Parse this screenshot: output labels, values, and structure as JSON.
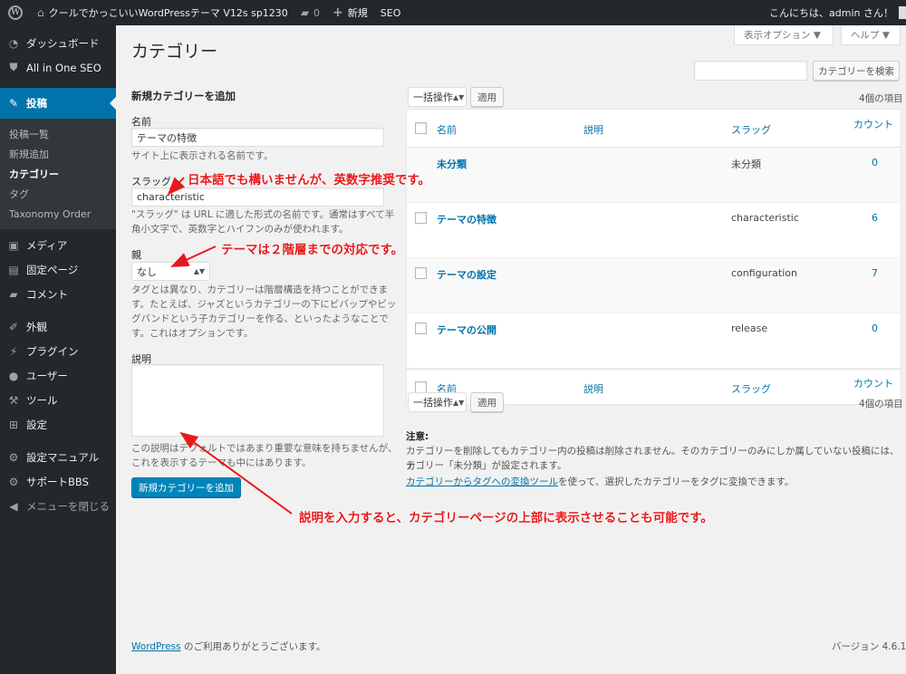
{
  "adminbar": {
    "wp_logo": "W",
    "site_name": "クールでかっこいいWordPressテーマ V12s sp1230",
    "comments_count": "0",
    "new_label": "新規",
    "seo_label": "SEO",
    "greeting": "こんにちは、admin さん！"
  },
  "sidebar": {
    "dashboard": "ダッシュボード",
    "aioseo": "All in One SEO",
    "posts": "投稿",
    "posts_sub": [
      "投稿一覧",
      "新規追加",
      "カテゴリー",
      "タグ",
      "Taxonomy Order"
    ],
    "media": "メディア",
    "pages": "固定ページ",
    "comments": "コメント",
    "appearance": "外観",
    "plugins": "プラグイン",
    "users": "ユーザー",
    "tools": "ツール",
    "settings": "設定",
    "settings_manual": "設定マニュアル",
    "support": "サポートBBS",
    "collapse": "メニューを閉じる"
  },
  "header": {
    "title": "カテゴリー",
    "screen_options": "表示オプション ▼",
    "help": "ヘルプ ▼",
    "search_button": "カテゴリーを検索",
    "search_value": ""
  },
  "form": {
    "heading": "新規カテゴリーを追加",
    "name_label": "名前",
    "name_value": "テーマの特徴",
    "name_desc": "サイト上に表示される名前です。",
    "slug_label": "スラッグ",
    "slug_value": "characteristic",
    "slug_desc_1": "\"スラッグ\" は URL に適した形式の名前です。通常はすべて半",
    "slug_desc_2": "角小文字で、英数字とハイフンのみが使われます。",
    "parent_label": "親",
    "parent_value": "なし",
    "parent_desc_1": "タグとは異なり、カテゴリーは階層構造を持つことができま",
    "parent_desc_2": "す。たとえば、ジャズというカテゴリーの下にビバップやビッ",
    "parent_desc_3": "グバンドという子カテゴリーを作る、といったようなことで",
    "parent_desc_4": "す。これはオプションです。",
    "desc_label": "説明",
    "desc_value": "",
    "desc_desc_1": "この説明はデフォルトではあまり重要な意味を持ちませんが、",
    "desc_desc_2": "これを表示するテーマも中にはあります。",
    "submit": "新規カテゴリーを追加"
  },
  "list": {
    "bulk_label": "一括操作",
    "apply": "適用",
    "count_text": "4個の項目",
    "columns": {
      "name": "名前",
      "description": "説明",
      "slug": "スラッグ",
      "count": "カウント"
    },
    "rows": [
      {
        "name": "未分類",
        "slug": "未分類",
        "count": "0"
      },
      {
        "name": "テーマの特徴",
        "slug": "characteristic",
        "count": "6"
      },
      {
        "name": "テーマの設定",
        "slug": "configuration",
        "count": "7"
      },
      {
        "name": "テーマの公開",
        "slug": "release",
        "count": "0"
      }
    ]
  },
  "note": {
    "title": "注意:",
    "line1": "カテゴリーを削除してもカテゴリー内の投稿は削除されません。そのカテゴリーのみにしか属していない投稿には、カ",
    "line2": "テゴリー「未分類」が設定されます。",
    "converter_link": "カテゴリーからタグへの変換ツール",
    "converter_rest": "を使って、選択したカテゴリーをタグに変換できます。"
  },
  "annotations": {
    "slug_note": "日本語でも構いませんが、英数字推奨です。",
    "parent_note": "テーマは２階層までの対応です。",
    "desc_note": "説明を入力すると、カテゴリーページの上部に表示させることも可能です。",
    "color": "#e8191c"
  },
  "footer": {
    "wp_link": "WordPress",
    "thanks": " のご利用ありがとうございます。",
    "version": "バージョン 4.6.1"
  }
}
